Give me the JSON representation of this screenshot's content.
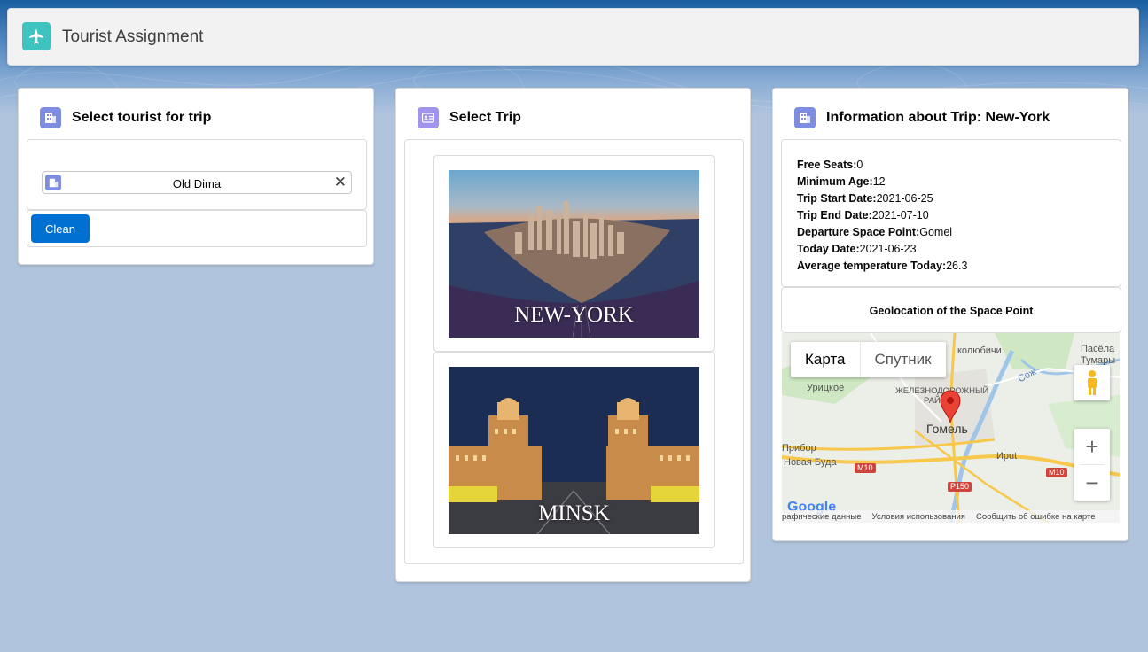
{
  "app": {
    "title": "Tourist Assignment",
    "icon": "airplane-icon"
  },
  "tourist_card": {
    "title": "Select tourist for trip",
    "icon": "account-icon",
    "selected_tourist": "Old Dima",
    "clean_label": "Clean"
  },
  "trip_card": {
    "title": "Select Trip",
    "icon": "contact-card-icon",
    "trips": [
      {
        "label": "NEW-YORK"
      },
      {
        "label": "MINSK"
      }
    ]
  },
  "info_card": {
    "title": "Information about Trip: New-York",
    "icon": "account-icon",
    "fields": [
      {
        "label": "Free Seats:",
        "value": "0"
      },
      {
        "label": "Minimum Age:",
        "value": "12"
      },
      {
        "label": "Trip Start Date:",
        "value": "2021-06-25"
      },
      {
        "label": "Trip End Date:",
        "value": "2021-07-10"
      },
      {
        "label": "Departure Space Point:",
        "value": "Gomel"
      },
      {
        "label": "Today Date:",
        "value": "2021-06-23"
      },
      {
        "label": "Average temperature Today:",
        "value": "26.3"
      }
    ],
    "geo_title": "Geolocation of the Space Point",
    "map": {
      "tab_map": "Карта",
      "tab_satellite": "Спутник",
      "city": "Гомель",
      "labels": {
        "nikolaevichi": "колюбичи",
        "pasela": "Пасёла",
        "tumary": "Тумары",
        "uritskoe": "Урицкое",
        "railway": "ЖЕЛЕЗНОДОРОЖНЫЙ",
        "railway2": "РАЙ",
        "pribor": "Прибор",
        "novaya_buda": "Новая Буда",
        "iput": "Иput",
        "sozh": "Сож"
      },
      "roads": {
        "m10a": "M10",
        "m10b": "M10",
        "p150": "P150"
      },
      "footer": {
        "data": "рафические данные",
        "terms": "Условия использования",
        "report": "Сообщить об ошибке на карте"
      },
      "google": "Google"
    }
  },
  "colors": {
    "accent": "#0070d2",
    "app_icon_bg": "#3fc3bf",
    "card_icon_bg": "#7f8de1",
    "page_bg": "#b0c4de"
  }
}
